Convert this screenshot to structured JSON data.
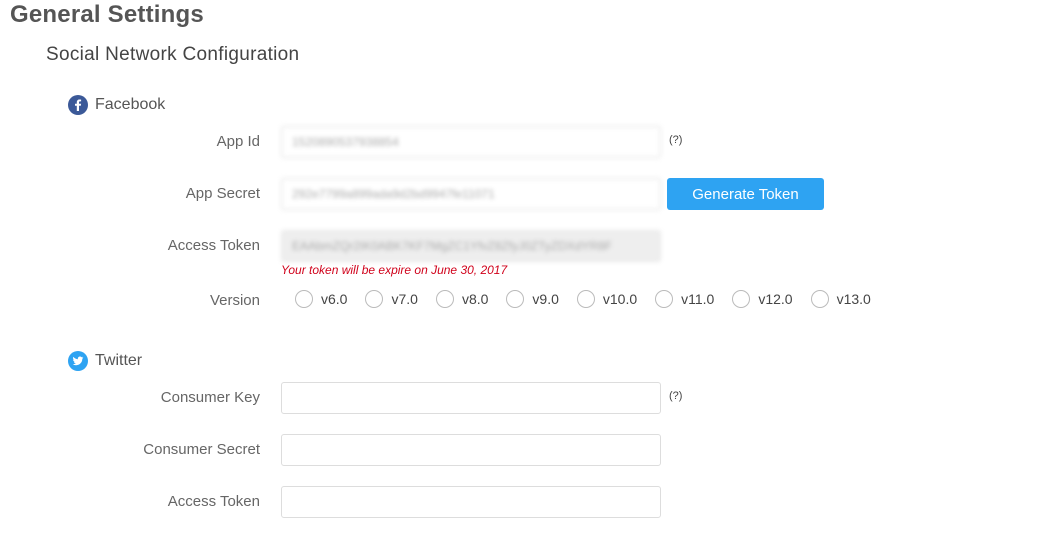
{
  "page": {
    "title": "General Settings",
    "section_title": "Social Network Configuration"
  },
  "facebook": {
    "name": "Facebook",
    "icon": "facebook-icon",
    "icon_color": "#3b5998",
    "app_id_label": "App Id",
    "app_id_value": "1520890537938854",
    "app_id_help": "(?)",
    "app_secret_label": "App Secret",
    "app_secret_value": "292e7799a899ada9d2bd9947fe11071",
    "generate_token_label": "Generate Token",
    "access_token_label": "Access Token",
    "access_token_value": "EAAbmZQr2IK0ABK7KF7MgZC1YfvZ8ZfyJ0ZTyZDXdYR8F",
    "token_expiry_text": "Your token will be expire on June 30, 2017",
    "version_label": "Version",
    "versions": [
      "v6.0",
      "v7.0",
      "v8.0",
      "v9.0",
      "v10.0",
      "v11.0",
      "v12.0",
      "v13.0"
    ]
  },
  "twitter": {
    "name": "Twitter",
    "icon": "twitter-icon",
    "icon_color": "#2ea3f2",
    "consumer_key_label": "Consumer Key",
    "consumer_key_value": "",
    "consumer_key_help": "(?)",
    "consumer_secret_label": "Consumer Secret",
    "consumer_secret_value": "",
    "access_token_label": "Access Token",
    "access_token_value": ""
  },
  "colors": {
    "accent": "#2ea3f2",
    "error": "#d0021b"
  }
}
